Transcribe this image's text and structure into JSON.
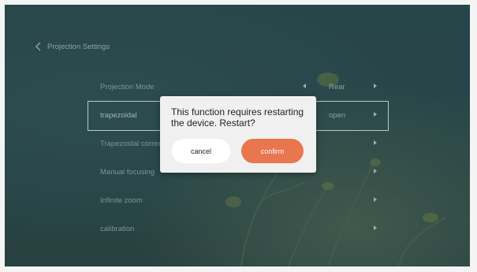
{
  "header": {
    "back_label": "Projection Settings"
  },
  "settings": [
    {
      "label": "Projection Mode",
      "value": "Rear"
    },
    {
      "label": "trapezoidal",
      "value": "open"
    },
    {
      "label": "Trapezoidal correct",
      "value": ""
    },
    {
      "label": "Manual focusing",
      "value": ""
    },
    {
      "label": "Infinite zoom",
      "value": ""
    },
    {
      "label": "calibration",
      "value": ""
    }
  ],
  "dialog": {
    "message": "This function requires restarting the device. Restart?",
    "cancel_label": "cancel",
    "confirm_label": "confirm"
  },
  "colors": {
    "accent": "#e9764f",
    "background": "#2e5255"
  },
  "icons": {
    "back": "chevron-left-icon",
    "prev": "arrow-left-icon",
    "next": "arrow-right-icon"
  }
}
